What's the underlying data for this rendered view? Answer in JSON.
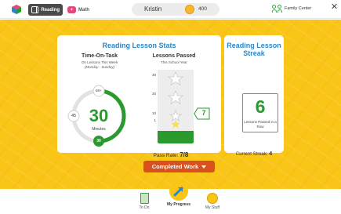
{
  "topbar": {
    "subjects": [
      {
        "label": "Reading",
        "active": true
      },
      {
        "label": "Math",
        "active": false
      }
    ],
    "user_name": "Kristin",
    "coins": "400",
    "family_center": "Family Center",
    "close_symbol": "✕"
  },
  "stats": {
    "title": "Reading Lesson Stats",
    "time_on_task": {
      "title": "Time-On-Task",
      "subtitle": "On Lessons This Week",
      "range": "(Monday - Sunday)",
      "value": "30",
      "unit": "Minutes",
      "marker_top": "60+",
      "marker_left": "45",
      "marker_bottom": "30",
      "fraction": 0.5
    },
    "lessons_passed": {
      "title": "Lessons Passed",
      "subtitle": "This School Year",
      "ticks": [
        "30",
        "20",
        "10",
        "1"
      ],
      "value": "7",
      "max": 30,
      "pass_rate_label": "Pass Rate:",
      "pass_rate_value": "7/8"
    }
  },
  "streak": {
    "title": "Reading Lesson Streak",
    "value": "6",
    "label": "Lessons Passed in a Row",
    "current_label": "Current Streak:",
    "current_value": "4"
  },
  "completed_button": "Completed Work",
  "bottom_nav": {
    "items": [
      {
        "label": "To Do",
        "active": false
      },
      {
        "label": "My Progress",
        "active": true
      },
      {
        "label": "My Stuff",
        "active": false
      }
    ]
  },
  "colors": {
    "accent_yellow": "#f9c517",
    "title_blue": "#2a87c9",
    "green": "#2a9a2f",
    "button_orange": "#d94f1e"
  }
}
